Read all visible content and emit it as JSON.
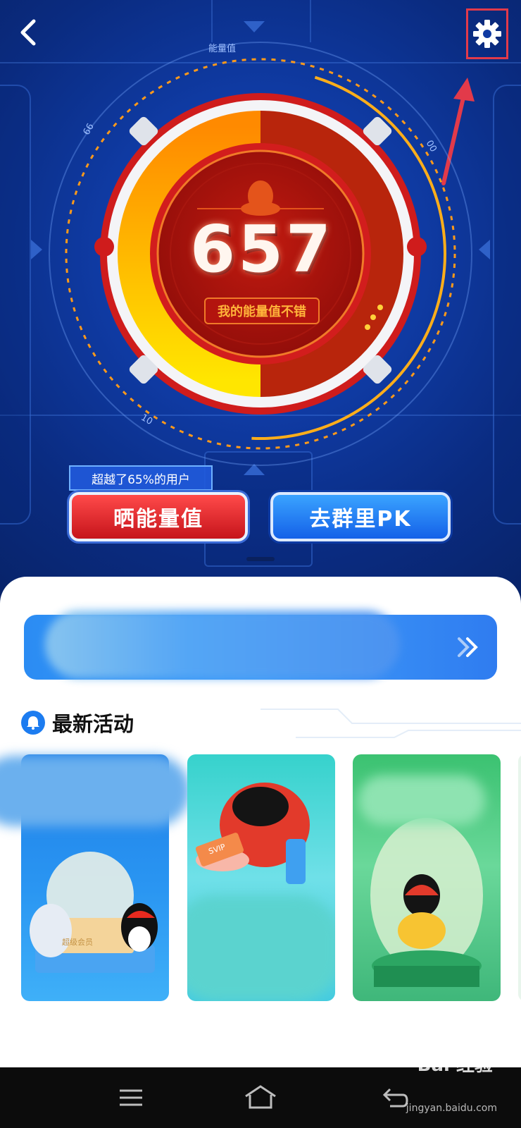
{
  "energy": {
    "gauge_label": "能量值",
    "tick_left": "66",
    "tick_right": "00",
    "tick_bottom": "10",
    "score": "657",
    "score_tag": "我的能量值不错",
    "progress_fraction": 0.657
  },
  "actions": {
    "beat_badge": "超越了65%的用户",
    "show_button": "晒能量值",
    "pk_button": "去群里PK"
  },
  "activities": {
    "title": "最新活动",
    "card2_tag": "SVIP",
    "card1_caption": "超级会员"
  },
  "watermark": {
    "brand": "Bai  经验",
    "url": "jingyan.baidu.com"
  },
  "colors": {
    "primary_blue": "#1c7cf0",
    "accent_red": "#e23a4a",
    "gauge_orange": "#ffb43a"
  },
  "icons": {
    "back": "chevron-left-icon",
    "settings": "gear-icon",
    "banner_arrow": "double-chevron-right-icon",
    "activity": "bell-icon",
    "menu": "menu-icon",
    "home": "home-icon",
    "back_nav": "back-icon"
  }
}
